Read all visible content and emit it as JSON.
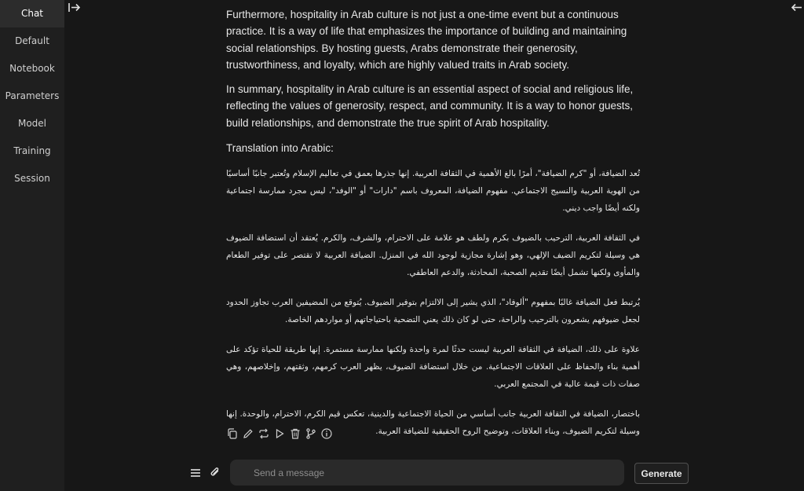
{
  "sidebar": {
    "items": [
      {
        "label": "Chat",
        "active": true
      },
      {
        "label": "Default"
      },
      {
        "label": "Notebook"
      },
      {
        "label": "Parameters"
      },
      {
        "label": "Model"
      },
      {
        "label": "Training"
      },
      {
        "label": "Session"
      }
    ]
  },
  "icons": {
    "toggle_left": "arrow-right-to-bar-icon",
    "toggle_right": "arrow-left-icon",
    "actions": [
      "copy-icon",
      "edit-icon",
      "regenerate-icon",
      "continue-icon",
      "delete-icon",
      "branch-icon",
      "info-icon"
    ],
    "menu": "hamburger-icon",
    "attach": "paperclip-icon"
  },
  "message": {
    "paragraphs_en": [
      "Furthermore, hospitality in Arab culture is not just a one-time event but a continuous practice. It is a way of life that emphasizes the importance of building and maintaining social relationships. By hosting guests, Arabs demonstrate their generosity, trustworthiness, and loyalty, which are highly valued traits in Arab society.",
      "In summary, hospitality in Arab culture is an essential aspect of social and religious life, reflecting the values of generosity, respect, and community. It is a way to honor guests, build relationships, and demonstrate the true spirit of Arab hospitality."
    ],
    "translation_label": "Translation into Arabic:",
    "paragraphs_ar": [
      "تُعد الضيافة، أو \"كرم الضيافة\"، أمرًا بالغ الأهمية في الثقافة العربية. إنها جذرها بعمق في تعاليم الإسلام وتُعتبر جانبًا أساسيًا من الهوية العربية والنسيج الاجتماعي. مفهوم الضيافة، المعروف باسم \"دارات\" أو \"الوفد\"، ليس مجرد ممارسة اجتماعية ولكنه أيضًا واجب ديني.",
      "في الثقافة العربية، الترحيب بالضيوف بكرم ولطف هو علامة على الاحترام، والشرف، والكرم. يُعتقد أن استضافة الضيوف هي وسيلة لتكريم الضيف الإلهي، وهو إشارة مجازية لوجود الله في المنزل. الضيافة العربية لا تقتصر على توفير الطعام والمأوى ولكنها تشمل أيضًا تقديم الصحبة، المحادثة، والدعم العاطفي.",
      "يُرتبط فعل الضيافة غالبًا بمفهوم \"ألوفاد\"، الذي يشير إلى الالتزام بتوفير الضيوف. يُتوقع من المضيفين العرب تجاوز الحدود لجعل ضيوفهم يشعرون بالترحيب والراحة، حتى لو كان ذلك يعني التضحية باحتياجاتهم أو مواردهم الخاصة.",
      "علاوة على ذلك، الضيافة في الثقافة العربية ليست حدثًا لمرة واحدة ولكنها ممارسة مستمرة. إنها طريقة للحياة تؤكد على أهمية بناء والحفاظ على العلاقات الاجتماعية. من خلال استضافة الضيوف، يظهر العرب كرمهم، وثقتهم، وإخلاصهم، وهي صفات ذات قيمة عالية في المجتمع العربي.",
      "باختصار، الضيافة في الثقافة العربية جانب أساسي من الحياة الاجتماعية والدينية، تعكس قيم الكرم، الاحترام، والوحدة. إنها وسيلة لتكريم الضيوف، وبناء العلاقات، وتوضيح الروح الحقيقية للضيافة العربية."
    ]
  },
  "input": {
    "placeholder": "Send a message",
    "value": ""
  },
  "buttons": {
    "generate": "Generate"
  }
}
